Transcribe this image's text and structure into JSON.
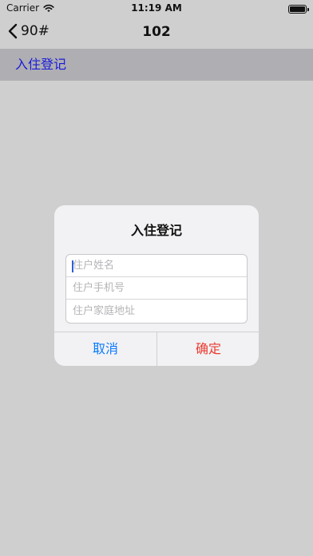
{
  "status_bar": {
    "carrier": "Carrier",
    "time": "11:19 AM",
    "battery_level": 1.0
  },
  "nav": {
    "back_label": "90#",
    "title": "102"
  },
  "section": {
    "header": "入住登记"
  },
  "dialog": {
    "title": "入住登记",
    "fields": [
      {
        "placeholder": "住户姓名",
        "value": ""
      },
      {
        "placeholder": "住户手机号",
        "value": ""
      },
      {
        "placeholder": "住户家庭地址",
        "value": ""
      }
    ],
    "cancel_label": "取消",
    "confirm_label": "确定"
  },
  "colors": {
    "background": "#cfcfcf",
    "section_header_bg": "#aeaeb3",
    "section_header_text": "#1a1ad9",
    "cancel_text": "#0a7aff",
    "confirm_text": "#ea3a30"
  }
}
